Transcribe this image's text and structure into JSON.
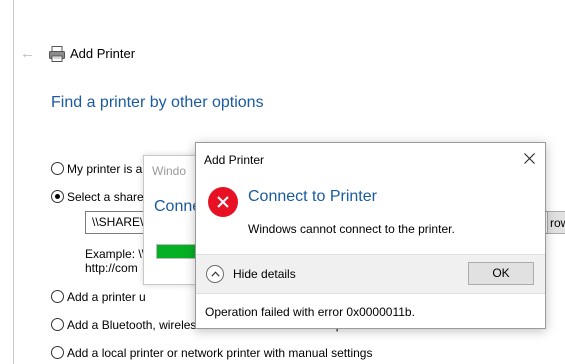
{
  "wizard": {
    "title": "Add Printer",
    "heading": "Find a printer by other options",
    "options": {
      "opt1": "My printer is a",
      "opt2": "Select a shared",
      "opt3": "Add a printer u",
      "opt4": "Add a Bluetooth, wireless or network discoverable printer",
      "opt5": "Add a local printer or network printer with manual settings"
    },
    "selected_option": "opt2",
    "share_path": "\\\\SHARE\\",
    "browse_label": "rowse",
    "example_line1": "Example: \\\\",
    "example_line2": "http://com"
  },
  "background_dialog": {
    "title": "Windo",
    "heading": "Conne",
    "progress_fraction": 1.0,
    "progress_color": "#06b025"
  },
  "error_dialog": {
    "title": "Add Printer",
    "heading": "Connect to Printer",
    "message": "Windows cannot connect to the printer.",
    "toggle_label": "Hide details",
    "ok_label": "OK",
    "details": "Operation failed with error 0x0000011b.",
    "icon": "error-icon",
    "icon_color": "#e81123",
    "heading_color": "#1a5a9e"
  }
}
